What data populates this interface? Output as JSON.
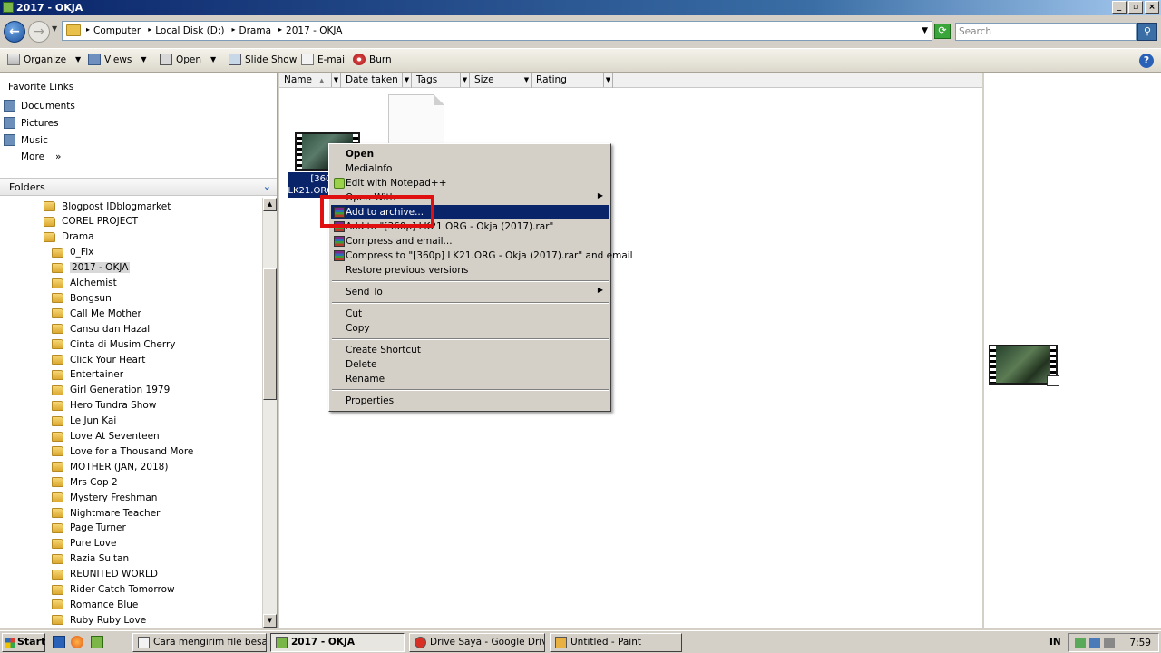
{
  "window": {
    "title": "2017 - OKJA"
  },
  "address": {
    "crumbs": [
      "Computer",
      "Local Disk (D:)",
      "Drama",
      "2017 - OKJA"
    ],
    "search_placeholder": "Search"
  },
  "toolbar": {
    "organize": "Organize",
    "views": "Views",
    "open": "Open",
    "slideshow": "Slide Show",
    "email": "E-mail",
    "burn": "Burn",
    "help": "?"
  },
  "favorites": {
    "header": "Favorite Links",
    "items": [
      "Documents",
      "Pictures",
      "Music"
    ],
    "more": "More"
  },
  "folders": {
    "header": "Folders",
    "items": [
      {
        "label": "Blogpost IDblogmarket",
        "indent": 0
      },
      {
        "label": "COREL PROJECT",
        "indent": 0
      },
      {
        "label": "Drama",
        "indent": 0
      },
      {
        "label": "0_Fix",
        "indent": 1
      },
      {
        "label": "2017 - OKJA",
        "indent": 1,
        "selected": true
      },
      {
        "label": "Alchemist",
        "indent": 1
      },
      {
        "label": "Bongsun",
        "indent": 1
      },
      {
        "label": "Call Me Mother",
        "indent": 1
      },
      {
        "label": "Cansu dan Hazal",
        "indent": 1
      },
      {
        "label": "Cinta di Musim Cherry",
        "indent": 1
      },
      {
        "label": "Click Your Heart",
        "indent": 1
      },
      {
        "label": "Entertainer",
        "indent": 1
      },
      {
        "label": "Girl Generation 1979",
        "indent": 1
      },
      {
        "label": "Hero Tundra Show",
        "indent": 1
      },
      {
        "label": "Le Jun Kai",
        "indent": 1
      },
      {
        "label": "Love At Seventeen",
        "indent": 1
      },
      {
        "label": "Love for a Thousand More",
        "indent": 1
      },
      {
        "label": "MOTHER (JAN, 2018)",
        "indent": 1
      },
      {
        "label": "Mrs Cop 2",
        "indent": 1
      },
      {
        "label": "Mystery Freshman",
        "indent": 1
      },
      {
        "label": "Nightmare Teacher",
        "indent": 1
      },
      {
        "label": "Page Turner",
        "indent": 1
      },
      {
        "label": "Pure Love",
        "indent": 1
      },
      {
        "label": "Razia Sultan",
        "indent": 1
      },
      {
        "label": "REUNITED WORLD",
        "indent": 1
      },
      {
        "label": "Rider Catch Tomorrow",
        "indent": 1
      },
      {
        "label": "Romance Blue",
        "indent": 1
      },
      {
        "label": "Ruby Ruby Love",
        "indent": 1
      }
    ]
  },
  "columns": [
    "Name",
    "Date taken",
    "Tags",
    "Size",
    "Rating"
  ],
  "files": {
    "selected_label": "[360p] LK21.ORG - Okja (2017)"
  },
  "context_menu": {
    "items": [
      {
        "label": "Open",
        "bold": true
      },
      {
        "label": "MediaInfo"
      },
      {
        "label": "Edit with Notepad++",
        "icon": "notepadpp-icon"
      },
      {
        "label": "Open With",
        "submenu": true
      },
      {
        "label": "Add to archive...",
        "icon": "winrar-icon",
        "highlighted": true
      },
      {
        "label": "Add to \"[360p] LK21.ORG - Okja (2017).rar\"",
        "icon": "winrar-icon"
      },
      {
        "label": "Compress and email...",
        "icon": "winrar-icon"
      },
      {
        "label": "Compress to \"[360p] LK21.ORG - Okja (2017).rar\" and email",
        "icon": "winrar-icon"
      },
      {
        "label": "Restore previous versions"
      },
      {
        "separator": true
      },
      {
        "label": "Send To",
        "submenu": true
      },
      {
        "separator": true
      },
      {
        "label": "Cut"
      },
      {
        "label": "Copy"
      },
      {
        "separator": true
      },
      {
        "label": "Create Shortcut"
      },
      {
        "label": "Delete"
      },
      {
        "label": "Rename"
      },
      {
        "separator": true
      },
      {
        "label": "Properties"
      }
    ]
  },
  "taskbar": {
    "start": "Start",
    "tasks": [
      {
        "label": "Cara mengirim file besar ...",
        "icon": "document-icon"
      },
      {
        "label": "2017 - OKJA",
        "icon": "folder-icon",
        "active": true
      },
      {
        "label": "Drive Saya - Google Driv...",
        "icon": "chrome-icon"
      },
      {
        "label": "Untitled - Paint",
        "icon": "paint-icon"
      }
    ],
    "lang": "IN",
    "clock": "7:59"
  }
}
